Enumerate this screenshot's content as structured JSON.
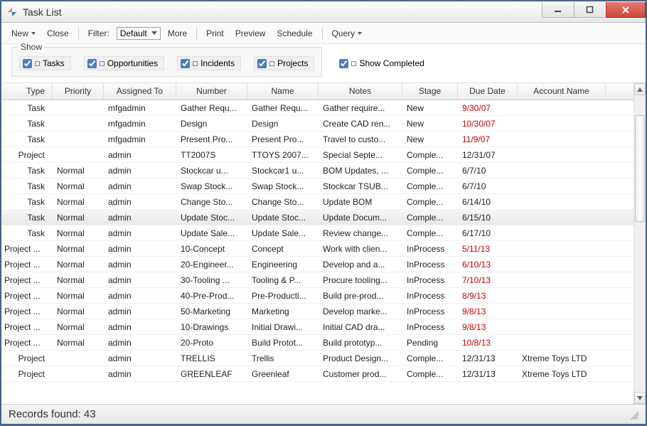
{
  "window": {
    "title": "Task List"
  },
  "toolbar": {
    "new": "New",
    "close": "Close",
    "filter_label": "Filter:",
    "filter_value": "Default",
    "more": "More",
    "print": "Print",
    "preview": "Preview",
    "schedule": "Schedule",
    "query": "Query"
  },
  "show_group": {
    "legend": "Show",
    "tasks": "Tasks",
    "opportunities": "Opportunities",
    "incidents": "Incidents",
    "projects": "Projects"
  },
  "show_completed": "Show Completed",
  "columns": {
    "type": "Type",
    "priority": "Priority",
    "assigned_to": "Assigned To",
    "number": "Number",
    "name": "Name",
    "notes": "Notes",
    "stage": "Stage",
    "due_date": "Due Date",
    "account_name": "Account Name"
  },
  "rows": [
    {
      "type": "Task",
      "priority": "",
      "assigned": "mfgadmin",
      "number": "Gather Requ...",
      "name": "Gather Requ...",
      "notes": "Gather require...",
      "stage": "New",
      "due": "9/30/07",
      "due_red": true,
      "account": ""
    },
    {
      "type": "Task",
      "priority": "",
      "assigned": "mfgadmin",
      "number": "Design",
      "name": "Design",
      "notes": "Create CAD ren...",
      "stage": "New",
      "due": "10/30/07",
      "due_red": true,
      "account": ""
    },
    {
      "type": "Task",
      "priority": "",
      "assigned": "mfgadmin",
      "number": "Present Pro...",
      "name": "Present Pro...",
      "notes": "Travel to custo...",
      "stage": "New",
      "due": "11/9/07",
      "due_red": true,
      "account": ""
    },
    {
      "type": "Project",
      "priority": "",
      "assigned": "admin",
      "number": "TT2007S",
      "name": "TTOYS 2007...",
      "notes": "Special Septe...",
      "stage": "Comple...",
      "due": "12/31/07",
      "due_red": false,
      "account": ""
    },
    {
      "type": "Task",
      "priority": "Normal",
      "assigned": "admin",
      "number": "Stockcar u...",
      "name": "Stockcar1 u...",
      "notes": "BOM Updates, ...",
      "stage": "Comple...",
      "due": "6/7/10",
      "due_red": false,
      "account": ""
    },
    {
      "type": "Task",
      "priority": "Normal",
      "assigned": "admin",
      "number": "Swap Stock...",
      "name": "Swap Stock...",
      "notes": "Stockcar TSUB...",
      "stage": "Comple...",
      "due": "6/7/10",
      "due_red": false,
      "account": ""
    },
    {
      "type": "Task",
      "priority": "Normal",
      "assigned": "admin",
      "number": "Change Sto...",
      "name": "Change Sto...",
      "notes": "Update BOM",
      "stage": "Comple...",
      "due": "6/14/10",
      "due_red": false,
      "account": ""
    },
    {
      "type": "Task",
      "priority": "Normal",
      "assigned": "admin",
      "number": "Update Stoc...",
      "name": "Update Stoc...",
      "notes": "Update Docum...",
      "stage": "Comple...",
      "due": "6/15/10",
      "due_red": false,
      "account": "",
      "hl": true
    },
    {
      "type": "Task",
      "priority": "Normal",
      "assigned": "admin",
      "number": "Update Sale...",
      "name": "Update Sale...",
      "notes": "Review change...",
      "stage": "Comple...",
      "due": "6/17/10",
      "due_red": false,
      "account": ""
    },
    {
      "type": "Project ...",
      "priority": "Normal",
      "assigned": "admin",
      "number": "10-Concept",
      "name": "Concept",
      "notes": "Work with clien...",
      "stage": "InProcess",
      "due": "5/11/13",
      "due_red": true,
      "account": ""
    },
    {
      "type": "Project ...",
      "priority": "Normal",
      "assigned": "admin",
      "number": "20-Engineer...",
      "name": "Engineering",
      "notes": "Develop and a...",
      "stage": "InProcess",
      "due": "6/10/13",
      "due_red": true,
      "account": ""
    },
    {
      "type": "Project ...",
      "priority": "Normal",
      "assigned": "admin",
      "number": "30-Tooling ...",
      "name": "Tooling & P...",
      "notes": "Procure tooling...",
      "stage": "InProcess",
      "due": "7/10/13",
      "due_red": true,
      "account": ""
    },
    {
      "type": "Project ...",
      "priority": "Normal",
      "assigned": "admin",
      "number": "40-Pre-Prod...",
      "name": "Pre-Producti...",
      "notes": "Build pre-prod...",
      "stage": "InProcess",
      "due": "8/9/13",
      "due_red": true,
      "account": ""
    },
    {
      "type": "Project ...",
      "priority": "Normal",
      "assigned": "admin",
      "number": "50-Marketing",
      "name": "Marketing",
      "notes": "Develop marke...",
      "stage": "InProcess",
      "due": "9/8/13",
      "due_red": true,
      "account": ""
    },
    {
      "type": "Project ...",
      "priority": "Normal",
      "assigned": "admin",
      "number": "10-Drawings",
      "name": "Initial Drawi...",
      "notes": "Initial CAD dra...",
      "stage": "InProcess",
      "due": "9/8/13",
      "due_red": true,
      "account": ""
    },
    {
      "type": "Project ...",
      "priority": "Normal",
      "assigned": "admin",
      "number": "20-Proto",
      "name": "Build Protot...",
      "notes": "Build prototyp...",
      "stage": "Pending",
      "due": "10/8/13",
      "due_red": true,
      "account": ""
    },
    {
      "type": "Project",
      "priority": "",
      "assigned": "admin",
      "number": "TRELLIS",
      "name": "Trellis",
      "notes": "Product Design...",
      "stage": "Comple...",
      "due": "12/31/13",
      "due_red": false,
      "account": "Xtreme Toys LTD"
    },
    {
      "type": "Project",
      "priority": "",
      "assigned": "admin",
      "number": "GREENLEAF",
      "name": "Greenleaf",
      "notes": "Customer prod...",
      "stage": "Comple...",
      "due": "12/31/13",
      "due_red": false,
      "account": "Xtreme Toys LTD"
    }
  ],
  "status": {
    "records_found_label": "Records found:",
    "records_found_count": "43"
  }
}
